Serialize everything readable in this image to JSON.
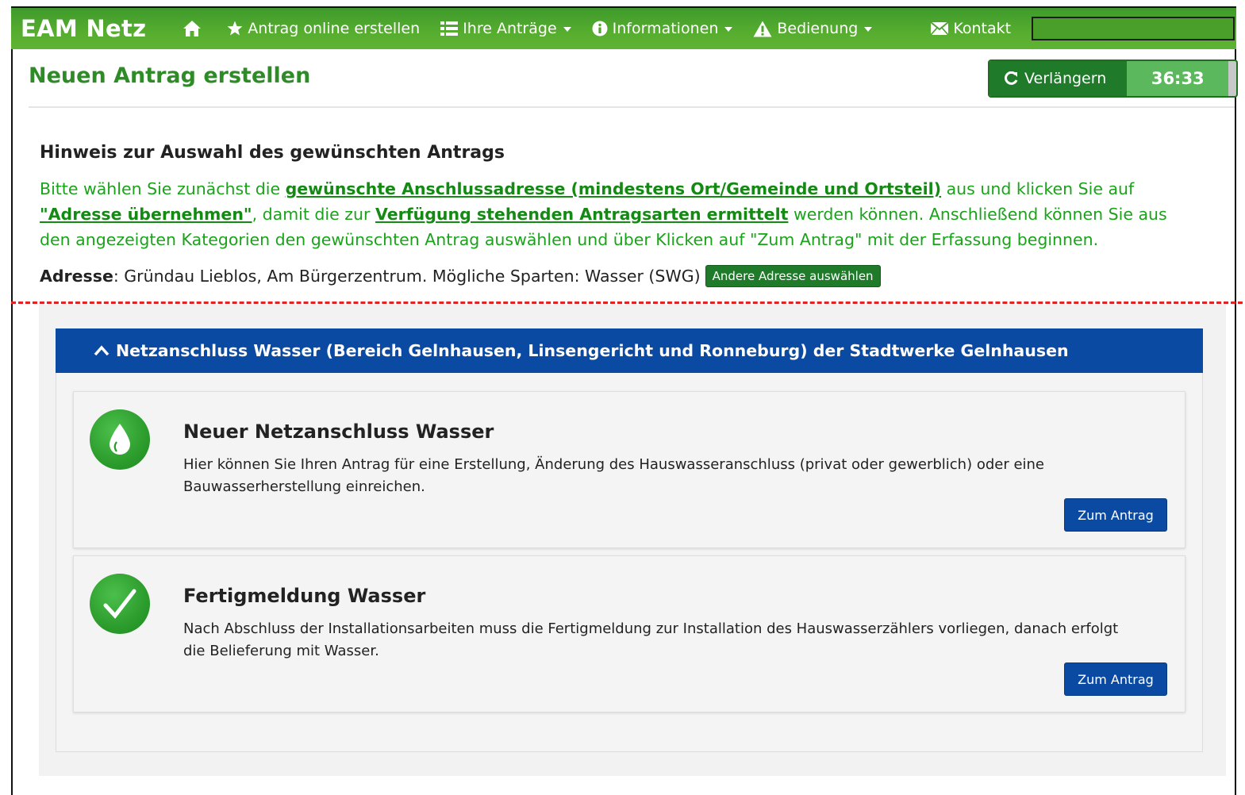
{
  "navbar": {
    "brand": "EAM Netz",
    "items": [
      {
        "label": "Antrag online erstellen",
        "icon": "star-icon",
        "dropdown": false
      },
      {
        "label": "Ihre Anträge",
        "icon": "list-icon",
        "dropdown": true
      },
      {
        "label": "Informationen",
        "icon": "info-icon",
        "dropdown": true
      },
      {
        "label": "Bedienung",
        "icon": "warning-icon",
        "dropdown": true
      },
      {
        "label": "Kontakt",
        "icon": "envelope-icon",
        "dropdown": false
      }
    ],
    "home_icon": "home-icon",
    "user_icon": "user-icon"
  },
  "header": {
    "title": "Neuen Antrag erstellen",
    "extend_label": "Verlängern",
    "timer": "36:33"
  },
  "hint": {
    "title": "Hinweis zur Auswahl des gewünschten Antrags",
    "p1": "Bitte wählen Sie zunächst die ",
    "link1": "gewünschte Anschlussadresse (mindestens Ort/Gemeinde und Ortsteil)",
    "p2": " aus und klicken Sie auf ",
    "link2": "\"Adresse übernehmen\"",
    "p3": ", damit die zur ",
    "link3": "Verfügung stehenden Antragsarten ermittelt",
    "p4": " werden können. Anschließend können Sie aus den angezeigten Kategorien den gewünschten Antrag auswählen und über Klicken auf \"Zum Antrag\" mit der Erfassung beginnen."
  },
  "address": {
    "label": "Adresse",
    "value": ": Gründau Lieblos, Am Bürgerzentrum. Mögliche Sparten: Wasser (SWG)",
    "change_button": "Andere Adresse auswählen"
  },
  "panel": {
    "title": "Netzanschluss Wasser (Bereich Gelnhausen, Linsengericht und Ronneburg) der Stadtwerke Gelnhausen",
    "cards": [
      {
        "title": "Neuer Netzanschluss Wasser",
        "description": "Hier können Sie Ihren Antrag für eine Erstellung, Änderung des Hauswasseranschluss (privat oder gewerblich) oder eine Bauwasserherstellung einreichen.",
        "button": "Zum Antrag",
        "icon": "water-drop-icon"
      },
      {
        "title": "Fertigmeldung Wasser",
        "description": "Nach Abschluss der Installationsarbeiten muss die Fertigmeldung zur Installation des Hauswasserzählers vorliegen, danach erfolgt die Belieferung mit Wasser.",
        "button": "Zum Antrag",
        "icon": "checkmark-icon"
      }
    ]
  },
  "colors": {
    "nav_green": "#56ad2e",
    "title_green": "#2e8b27",
    "hint_green": "#1aa31a",
    "panel_blue": "#0b4aa2",
    "timer_green": "#5cb85c"
  }
}
